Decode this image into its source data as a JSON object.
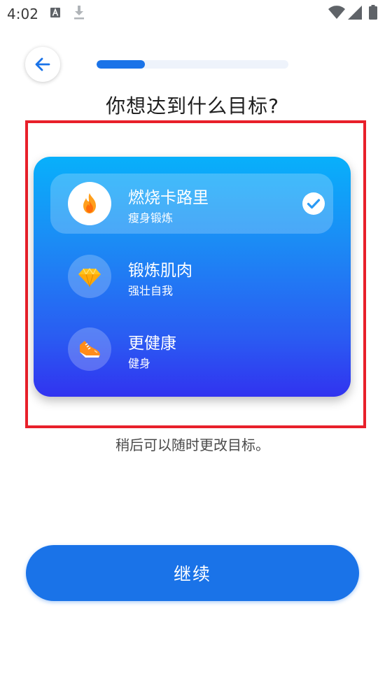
{
  "status_bar": {
    "time": "4:02",
    "icons": [
      "a-notification-icon",
      "download-icon",
      "wifi-icon",
      "signal-icon",
      "battery-icon"
    ]
  },
  "header": {
    "back_icon": "arrow-left-icon",
    "progress_fraction": 0.25,
    "accent_color": "#1a73e8"
  },
  "title": "你想达到什么目标?",
  "goals": [
    {
      "title": "燃烧卡路里",
      "subtitle": "瘦身锻炼",
      "icon": "flame-icon",
      "selected": true
    },
    {
      "title": "锻炼肌肉",
      "subtitle": "强壮自我",
      "icon": "diamond-icon",
      "selected": false
    },
    {
      "title": "更健康",
      "subtitle": "健身",
      "icon": "sneaker-icon",
      "selected": false
    }
  ],
  "hint": "稍后可以随时更改目标。",
  "continue_label": "继续",
  "colors": {
    "card_gradient_top": "#08b0fb",
    "card_gradient_bottom": "#3133f0",
    "highlight_border": "#e8202a"
  }
}
